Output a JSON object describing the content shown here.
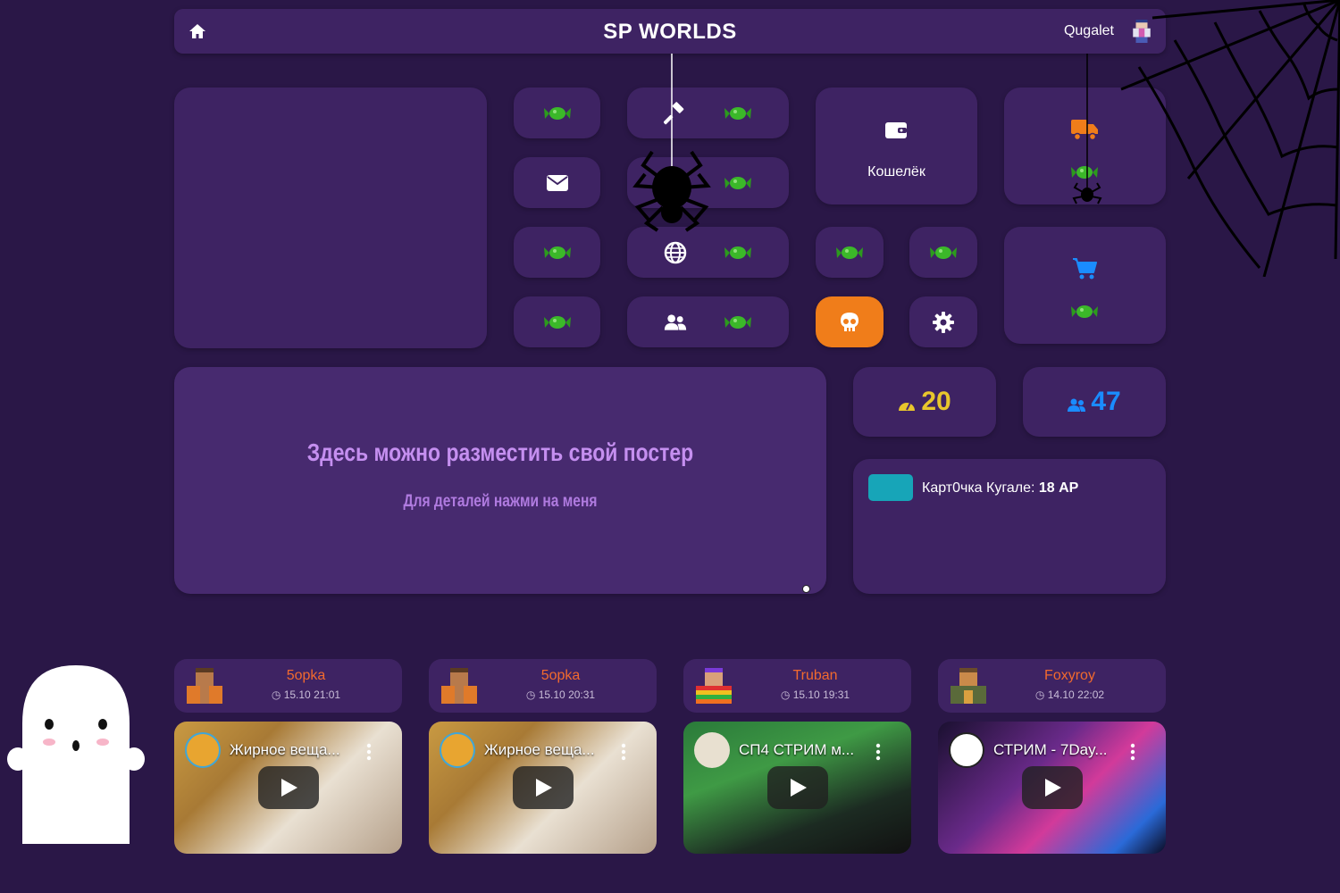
{
  "header": {
    "title": "SP WORLDS",
    "username": "Qugalet"
  },
  "wallet": {
    "label": "Кошелёк"
  },
  "poster": {
    "title": "Здесь можно разместить свой постер",
    "subtitle": "Для деталей нажми на меня"
  },
  "stats": {
    "ping": "20",
    "online": "47"
  },
  "card": {
    "prefix": "Карт0чка Кугале: ",
    "amount": "18 АР"
  },
  "videos": [
    {
      "author": "5opka",
      "date": "15.10 21:01",
      "title": "Жирное веща..."
    },
    {
      "author": "5opka",
      "date": "15.10 20:31",
      "title": "Жирное веща..."
    },
    {
      "author": "Truban",
      "date": "15.10 19:31",
      "title": "СП4 СТРИМ м..."
    },
    {
      "author": "Foxyroy",
      "date": "14.10 22:02",
      "title": "СТРИМ - 7Day..."
    }
  ],
  "colors": {
    "background": "#2a1747",
    "card": "#3e2363",
    "accent_orange": "#f07d1a",
    "stat_yellow": "#e8c62c",
    "stat_blue": "#1a8cff",
    "poster_text": "#c58ff0",
    "author": "#f26a2e"
  }
}
